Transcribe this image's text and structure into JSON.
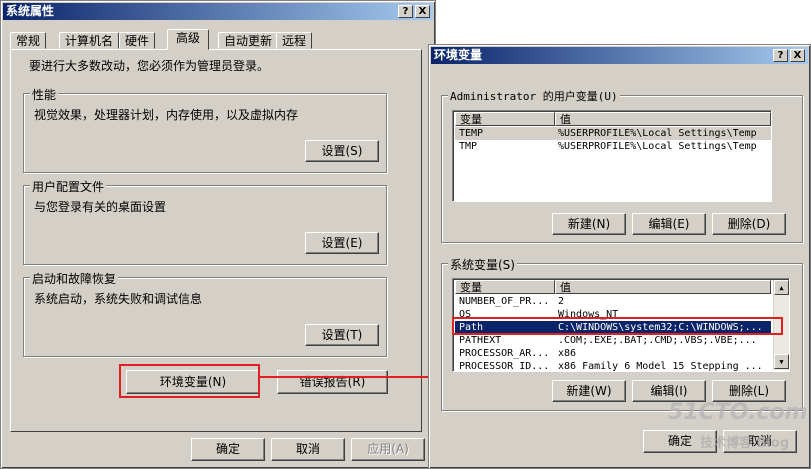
{
  "sysprop": {
    "title": "系统属性",
    "help_btn": "?",
    "close_btn": "X",
    "tabs": [
      "常规",
      "计算机名",
      "硬件",
      "高级",
      "自动更新",
      "远程"
    ],
    "active_tab": "高级",
    "admin_note": "要进行大多数改动，您必须作为管理员登录。",
    "perf": {
      "label": "性能",
      "desc": "视觉效果，处理器计划，内存使用，以及虚拟内存",
      "btn": "设置(S)"
    },
    "profile": {
      "label": "用户配置文件",
      "desc": "与您登录有关的桌面设置",
      "btn": "设置(E)"
    },
    "startup": {
      "label": "启动和故障恢复",
      "desc": "系统启动，系统失败和调试信息",
      "btn": "设置(T)"
    },
    "env_btn": "环境变量(N)",
    "error_btn": "错误报告(R)",
    "ok": "确定",
    "cancel": "取消",
    "apply": "应用(A)"
  },
  "envvars": {
    "title": "环境变量",
    "help_btn": "?",
    "close_btn": "X",
    "user_group": "Administrator 的用户变量(U)",
    "col_var": "变量",
    "col_val": "值",
    "user_rows": [
      {
        "var": "TEMP",
        "val": "%USERPROFILE%\\Local Settings\\Temp"
      },
      {
        "var": "TMP",
        "val": "%USERPROFILE%\\Local Settings\\Temp"
      }
    ],
    "user_new": "新建(N)",
    "user_edit": "编辑(E)",
    "user_delete": "删除(D)",
    "sys_group": "系统变量(S)",
    "sys_rows": [
      {
        "var": "NUMBER_OF_PR...",
        "val": "2"
      },
      {
        "var": "OS",
        "val": "Windows_NT"
      },
      {
        "var": "Path",
        "val": "C:\\WINDOWS\\system32;C:\\WINDOWS;..."
      },
      {
        "var": "PATHEXT",
        "val": ".COM;.EXE;.BAT;.CMD;.VBS;.VBE;..."
      },
      {
        "var": "PROCESSOR_AR...",
        "val": "x86"
      },
      {
        "var": "PROCESSOR_ID...",
        "val": "x86 Family 6 Model 15 Stepping ..."
      }
    ],
    "sys_new": "新建(W)",
    "sys_edit": "编辑(I)",
    "sys_delete": "删除(L)",
    "ok": "确定",
    "cancel": "取消"
  },
  "watermark": {
    "site": "51CTO.com",
    "sub": "技术博客  Blog"
  },
  "colors": {
    "highlight": "#e02020",
    "selection": "#0a246a",
    "titlebar": "#0a246a"
  }
}
